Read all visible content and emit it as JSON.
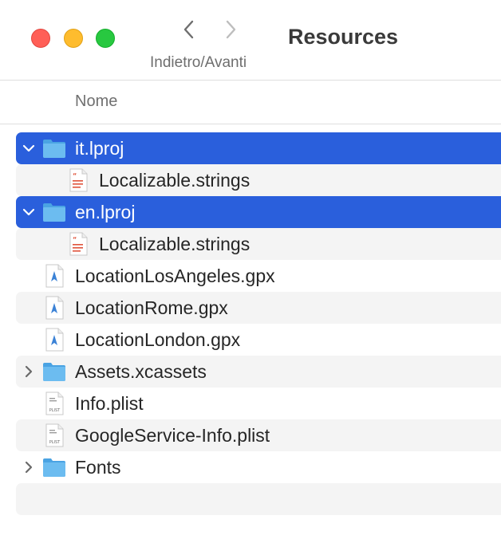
{
  "window": {
    "title": "Resources",
    "nav_label": "Indietro/Avanti"
  },
  "columns": {
    "name_header": "Nome"
  },
  "rows": [
    {
      "label": "it.lproj",
      "icon": "folder-icon",
      "indent": 0,
      "disclosure": "expanded",
      "selected": true
    },
    {
      "label": "Localizable.strings",
      "icon": "strings-file-icon",
      "indent": 1,
      "disclosure": "none",
      "selected": false
    },
    {
      "label": "en.lproj",
      "icon": "folder-icon",
      "indent": 0,
      "disclosure": "expanded",
      "selected": true
    },
    {
      "label": "Localizable.strings",
      "icon": "strings-file-icon",
      "indent": 1,
      "disclosure": "none",
      "selected": false
    },
    {
      "label": "LocationLosAngeles.gpx",
      "icon": "gpx-file-icon",
      "indent": 0,
      "disclosure": "none",
      "selected": false
    },
    {
      "label": "LocationRome.gpx",
      "icon": "gpx-file-icon",
      "indent": 0,
      "disclosure": "none",
      "selected": false
    },
    {
      "label": "LocationLondon.gpx",
      "icon": "gpx-file-icon",
      "indent": 0,
      "disclosure": "none",
      "selected": false
    },
    {
      "label": "Assets.xcassets",
      "icon": "folder-icon",
      "indent": 0,
      "disclosure": "collapsed",
      "selected": false
    },
    {
      "label": "Info.plist",
      "icon": "plist-file-icon",
      "indent": 0,
      "disclosure": "none",
      "selected": false
    },
    {
      "label": "GoogleService-Info.plist",
      "icon": "plist-file-icon",
      "indent": 0,
      "disclosure": "none",
      "selected": false
    },
    {
      "label": "Fonts",
      "icon": "folder-icon",
      "indent": 0,
      "disclosure": "collapsed",
      "selected": false
    },
    {
      "label": "",
      "icon": "",
      "indent": 0,
      "disclosure": "none",
      "selected": false
    }
  ],
  "icon_text": {
    "plist": "PLIST"
  },
  "colors": {
    "selection": "#2a5fdc",
    "alt_row": "#f4f4f4",
    "folder": "#5fb3ec",
    "close": "#ff5f57",
    "minimize": "#febc2e",
    "zoom": "#28c840"
  }
}
